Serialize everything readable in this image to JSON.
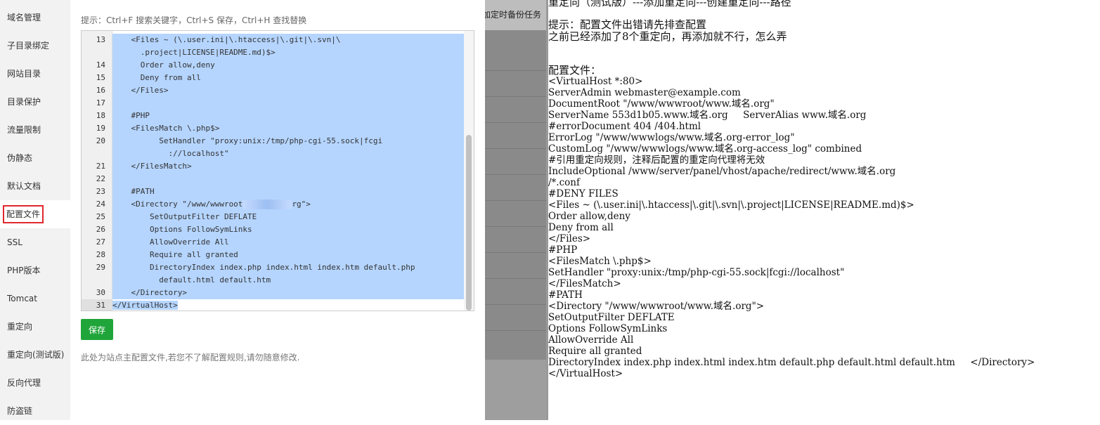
{
  "sidebar": {
    "items": [
      {
        "label": "域名管理"
      },
      {
        "label": "子目录绑定"
      },
      {
        "label": "网站目录"
      },
      {
        "label": "目录保护"
      },
      {
        "label": "流量限制"
      },
      {
        "label": "伪静态"
      },
      {
        "label": "默认文档"
      },
      {
        "label": "配置文件",
        "active": true
      },
      {
        "label": "SSL"
      },
      {
        "label": "PHP版本"
      },
      {
        "label": "Tomcat"
      },
      {
        "label": "重定向"
      },
      {
        "label": "重定向(测试版)"
      },
      {
        "label": "反向代理"
      },
      {
        "label": "防盗链"
      }
    ]
  },
  "editor": {
    "tip": "提示：Ctrl+F 搜索关键字，Ctrl+S 保存，Ctrl+H 查找替换",
    "lines": [
      {
        "num": "13",
        "text": "    <Files ~ (\\.user.ini|\\.htaccess|\\.git|\\.svn|\\"
      },
      {
        "num": "",
        "text": "      .project|LICENSE|README.md)$>"
      },
      {
        "num": "14",
        "text": "      Order allow,deny"
      },
      {
        "num": "15",
        "text": "      Deny from all"
      },
      {
        "num": "16",
        "text": "    </Files>"
      },
      {
        "num": "17",
        "text": ""
      },
      {
        "num": "18",
        "text": "    #PHP"
      },
      {
        "num": "19",
        "text": "    <FilesMatch \\.php$>"
      },
      {
        "num": "20",
        "text": "          SetHandler \"proxy:unix:/tmp/php-cgi-55.sock|fcgi"
      },
      {
        "num": "",
        "text": "            ://localhost\""
      },
      {
        "num": "21",
        "text": "    </FilesMatch>"
      },
      {
        "num": "22",
        "text": ""
      },
      {
        "num": "23",
        "text": "    #PATH"
      },
      {
        "num": "24",
        "text": "    <Directory \"/www/wwwroot"
      },
      {
        "num": "25",
        "text": "        SetOutputFilter DEFLATE"
      },
      {
        "num": "26",
        "text": "        Options FollowSymLinks"
      },
      {
        "num": "27",
        "text": "        AllowOverride All"
      },
      {
        "num": "28",
        "text": "        Require all granted"
      },
      {
        "num": "29",
        "text": "        DirectoryIndex index.php index.html index.htm default.php"
      },
      {
        "num": "",
        "text": "          default.html default.htm"
      },
      {
        "num": "30",
        "text": "    </Directory>"
      },
      {
        "num": "31",
        "text": "</VirtualHost>"
      }
    ],
    "line24_tail": "rg\">",
    "save_label": "保存",
    "note": "此处为站点主配置文件,若您不了解配置规则,请勿随意修改."
  },
  "backdrop": {
    "text": "加定时备份任务"
  },
  "textpane": {
    "lines": [
      "重定向（测试版）---添加重定向---创建重定向---路径",
      "",
      "提示：配置文件出错请先排查配置",
      "之前已经添加了8个重定向，再添加就不行，怎么弄",
      "",
      "",
      "配置文件：",
      "<VirtualHost *:80>",
      "ServerAdmin webmaster@example.com",
      "DocumentRoot \"/www/wwwroot/www.域名.org\"",
      "ServerName 553d1b05.www.域名.org     ServerAlias www.域名.org",
      "#errorDocument 404 /404.html",
      "ErrorLog \"/www/wwwlogs/www.域名.org-error_log\"",
      "CustomLog \"/www/wwwlogs/www.域名.org-access_log\" combined",
      "#引用重定向规则，注释后配置的重定向代理将无效",
      "IncludeOptional /www/server/panel/vhost/apache/redirect/www.域名.org",
      "/*.conf",
      "#DENY FILES",
      "<Files ~ (\\.user.ini|\\.htaccess|\\.git|\\.svn|\\.project|LICENSE|README.md)$>",
      "Order allow,deny",
      "Deny from all",
      "</Files>",
      "#PHP",
      "<FilesMatch \\.php$>",
      "SetHandler \"proxy:unix:/tmp/php-cgi-55.sock|fcgi://localhost\"",
      "</FilesMatch>",
      "#PATH",
      "<Directory \"/www/wwwroot/www.域名.org\">",
      "SetOutputFilter DEFLATE",
      "Options FollowSymLinks",
      "AllowOverride All",
      "Require all granted",
      "DirectoryIndex index.php index.html index.htm default.php default.html default.htm     </Directory>",
      "</VirtualHost>"
    ]
  }
}
